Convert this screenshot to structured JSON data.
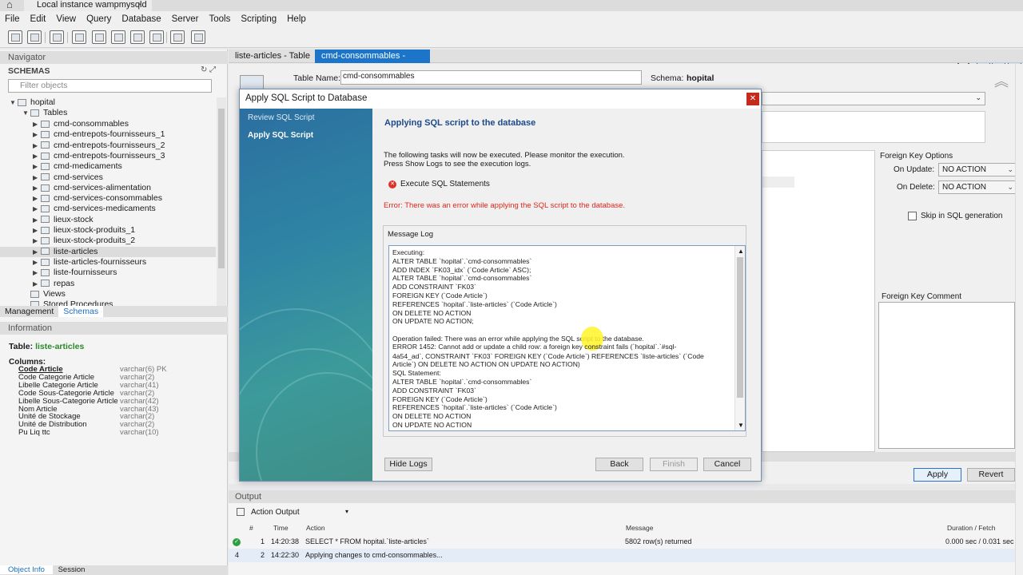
{
  "window": {
    "instance_tab": "Local instance wampmysqld",
    "close": "×"
  },
  "menu": [
    "File",
    "Edit",
    "View",
    "Query",
    "Database",
    "Server",
    "Tools",
    "Scripting",
    "Help"
  ],
  "navigator": {
    "header": "Navigator",
    "schemas_label": "SCHEMAS",
    "filter_placeholder": "Filter objects",
    "schema": "hopital",
    "tables_label": "Tables",
    "tables": [
      "cmd-consommables",
      "cmd-entrepots-fournisseurs_1",
      "cmd-entrepots-fournisseurs_2",
      "cmd-entrepots-fournisseurs_3",
      "cmd-medicaments",
      "cmd-services",
      "cmd-services-alimentation",
      "cmd-services-consommables",
      "cmd-services-medicaments",
      "lieux-stock",
      "lieux-stock-produits_1",
      "lieux-stock-produits_2",
      "liste-articles",
      "liste-articles-fournisseurs",
      "liste-fournisseurs",
      "repas"
    ],
    "views": "Views",
    "stored": "Stored Procedures",
    "tab_management": "Management",
    "tab_schemas": "Schemas"
  },
  "information": {
    "header": "Information",
    "table_label": "Table:",
    "table_name": "liste-articles",
    "columns_label": "Columns:",
    "columns": [
      {
        "name": "Code Article",
        "type": "varchar(6) PK"
      },
      {
        "name": "Code Categorie Article",
        "type": "varchar(2)"
      },
      {
        "name": "Libelle Categorie Article",
        "type": "varchar(41)"
      },
      {
        "name": "Code Sous-Categorie Article",
        "type": "varchar(2)"
      },
      {
        "name": "Libelle Sous-Categorie Article",
        "type": "varchar(42)"
      },
      {
        "name": "Nom Article",
        "type": "varchar(43)"
      },
      {
        "name": "Unité de Stockage",
        "type": "varchar(2)"
      },
      {
        "name": "Unité de Distribution",
        "type": "varchar(2)"
      },
      {
        "name": "Pu Liq ttc",
        "type": "varchar(10)"
      }
    ],
    "tab_object": "Object Info",
    "tab_session": "Session"
  },
  "editor": {
    "tab1": "liste-articles - Table",
    "tab2": "cmd-consommables - Table",
    "table_name_label": "Table Name:",
    "table_name_value": "cmd-consommables",
    "schema_label": "Schema:",
    "schema_value": "hopital",
    "fk_options": "Foreign Key Options",
    "on_update_label": "On Update:",
    "on_update_value": "NO ACTION",
    "on_delete_label": "On Delete:",
    "on_delete_value": "NO ACTION",
    "skip_label": "Skip in SQL generation",
    "fk_comment": "Foreign Key Comment",
    "apply": "Apply",
    "revert": "Revert"
  },
  "output": {
    "header": "Output",
    "action_output": "Action Output",
    "cols": [
      "#",
      "Time",
      "Action",
      "Message",
      "Duration / Fetch"
    ],
    "rows": [
      {
        "n": "1",
        "time": "14:20:38",
        "action": "SELECT * FROM hopital.`liste-articles`",
        "message": "5802 row(s) returned",
        "duration": "0.000 sec / 0.031 sec"
      },
      {
        "n": "2",
        "time": "14:22:30",
        "action": "Applying changes to cmd-consommables...",
        "message": "",
        "duration": ""
      }
    ]
  },
  "dialog": {
    "title": "Apply SQL Script to Database",
    "steps": [
      "Review SQL Script",
      "Apply SQL Script"
    ],
    "heading": "Applying SQL script to the database",
    "desc1": "The following tasks will now be executed. Please monitor the execution.",
    "desc2": "Press Show Logs to see the execution logs.",
    "task": "Execute SQL Statements",
    "error": "Error: There was an error while applying the SQL script to the database.",
    "msglog_label": "Message Log",
    "log": [
      "Executing:",
      "ALTER TABLE `hopital`.`cmd-consommables`",
      "ADD INDEX `FK03_idx` (`Code Article` ASC);",
      "ALTER TABLE `hopital`.`cmd-consommables`",
      "ADD CONSTRAINT `FK03`",
      "  FOREIGN KEY (`Code Article`)",
      "  REFERENCES `hopital`.`liste-articles` (`Code Article`)",
      "  ON DELETE NO ACTION",
      "  ON UPDATE NO ACTION;",
      "",
      "Operation failed: There was an error while applying the SQL script to the database.",
      "",
      "4a54_ad`, CONSTRAINT `FK03` FOREIGN KEY (`Code Article`) REFERENCES `liste-articles` (`Code",
      "Article`) ON DELETE NO ACTION ON UPDATE NO ACTION)",
      "SQL Statement:",
      "ALTER TABLE `hopital`.`cmd-consommables`",
      "ADD CONSTRAINT `FK03`",
      "  FOREIGN KEY (`Code Article`)",
      "  REFERENCES `hopital`.`liste-articles` (`Code Article`)",
      "  ON DELETE NO ACTION",
      "  ON UPDATE NO ACTION"
    ],
    "err_highlight": "ERROR 1452: Cannot add or update a child row: a foreign key",
    "err_rest": " constraint fails (`hopital`.`#sql-",
    "hide_logs": "Hide Logs",
    "back": "Back",
    "finish": "Finish",
    "cancel": "Cancel"
  }
}
